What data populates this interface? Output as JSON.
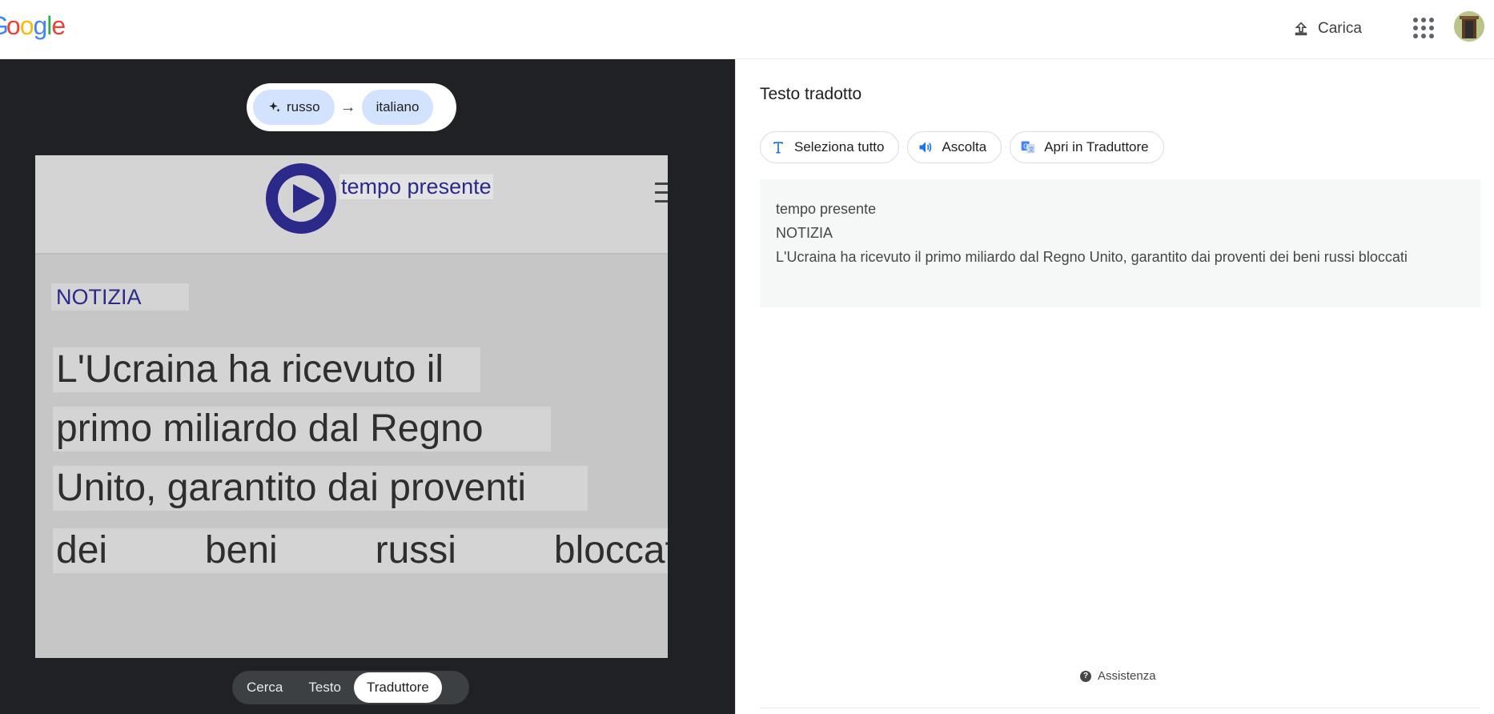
{
  "header": {
    "logo_letters": [
      {
        "char": "o",
        "color": "#EA4335"
      },
      {
        "char": "o",
        "color": "#FBBC05"
      },
      {
        "char": "g",
        "color": "#4285F4"
      },
      {
        "char": "l",
        "color": "#34A853"
      },
      {
        "char": "e",
        "color": "#EA4335"
      }
    ],
    "logo_partial": "G",
    "upload_label": "Carica",
    "apps_icon": "apps-grid-icon",
    "avatar_icon": "user-avatar"
  },
  "left": {
    "source_lang": "russo",
    "target_lang": "italiano",
    "arrow": "→",
    "image_overlay": {
      "site_name": "tempo presente",
      "section": "NOTIZIA",
      "lines": [
        "L'Ucraina ha ricevuto il",
        "primo miliardo dal Regno",
        "Unito, garantito dai proventi"
      ],
      "last_line_words": [
        "dei",
        "beni",
        "russi",
        "bloccat"
      ]
    },
    "modes": [
      "Cerca",
      "Testo",
      "Traduttore"
    ],
    "active_mode": "Traduttore"
  },
  "right": {
    "title": "Testo tradotto",
    "actions": {
      "select_all": "Seleziona tutto",
      "listen": "Ascolta",
      "open_translator": "Apri in Traduttore"
    },
    "translation": {
      "line1": "tempo presente",
      "line2": "NOTIZIA",
      "line3": "L'Ucraina ha ricevuto il primo miliardo dal Regno Unito, garantito dai proventi dei beni russi bloccati"
    },
    "help": "Assistenza"
  },
  "colors": {
    "dark_panel": "#202124",
    "chip_blue": "#d3e3fd",
    "brand_blue": "#1a73e8",
    "site_navy": "#2b2a8a"
  }
}
